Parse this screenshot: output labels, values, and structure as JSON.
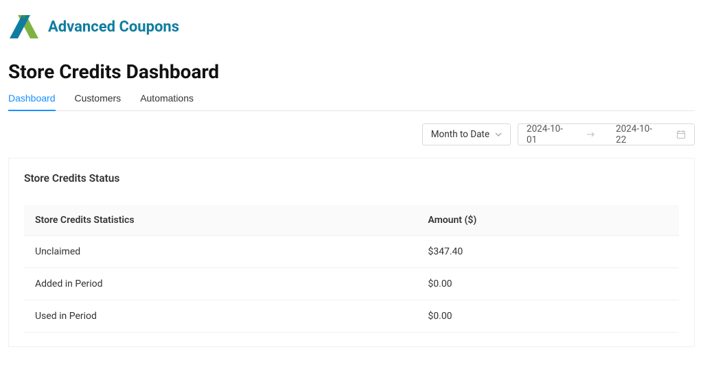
{
  "brand": {
    "name": "Advanced Coupons"
  },
  "page": {
    "title": "Store Credits Dashboard"
  },
  "tabs": [
    {
      "label": "Dashboard",
      "active": true
    },
    {
      "label": "Customers",
      "active": false
    },
    {
      "label": "Automations",
      "active": false
    }
  ],
  "filters": {
    "period_label": "Month to Date",
    "date_start": "2024-10-01",
    "date_end": "2024-10-22"
  },
  "card": {
    "title": "Store Credits Status",
    "columns": [
      "Store Credits Statistics",
      "Amount ($)"
    ],
    "rows": [
      {
        "label": "Unclaimed",
        "amount": "$347.40"
      },
      {
        "label": "Added in Period",
        "amount": "$0.00"
      },
      {
        "label": "Used in Period",
        "amount": "$0.00"
      }
    ]
  },
  "colors": {
    "accent": "#1890ff",
    "brand_teal": "#0f7d9f"
  }
}
